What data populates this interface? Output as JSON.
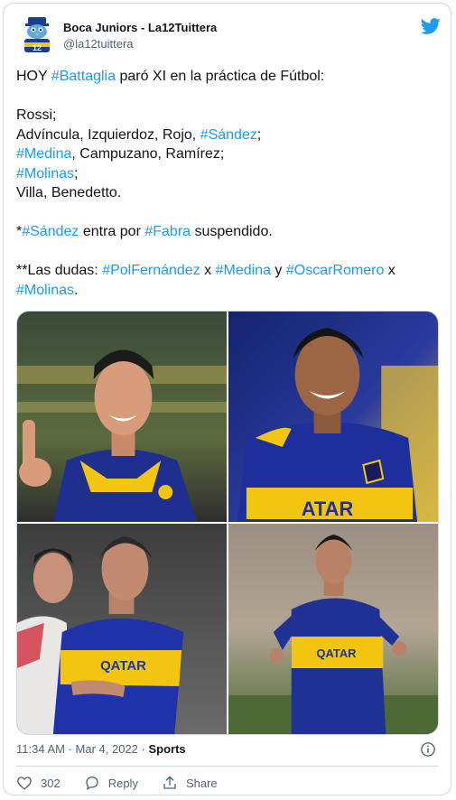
{
  "account": {
    "display_name": "Boca Juniors - La12Tuittera",
    "handle": "@la12tuittera",
    "avatar_icon": "avatar-bird-logo",
    "brand_color": "#1d9bf0"
  },
  "tweet": {
    "line1": {
      "a": "HOY ",
      "b": "#Battaglia",
      "c": " paró XI en la práctica de Fútbol:"
    },
    "line2": "Rossi;",
    "line3": {
      "a": "Advíncula, Izquierdoz, Rojo, ",
      "b": "#Sández",
      "c": ";"
    },
    "line4": {
      "a": "#Medina",
      "b": ", Campuzano, Ramírez;"
    },
    "line5": {
      "a": "#Molinas",
      "b": ";"
    },
    "line6": "Villa, Benedetto.",
    "line7": {
      "a": "*",
      "b": "#Sández",
      "c": " entra por ",
      "d": "#Fabra",
      "e": " suspendido."
    },
    "line8": {
      "a": "**Las dudas: ",
      "b": "#PolFernández",
      "c": " x ",
      "d": "#Medina",
      "e": " y ",
      "f": "#OscarRomero",
      "g": " x"
    },
    "line9": {
      "a": "#Molinas",
      "b": "."
    }
  },
  "meta": {
    "time": "11:34 AM",
    "separator": " · ",
    "date": "Mar 4, 2022",
    "category": "Sports"
  },
  "actions": {
    "likes": "302",
    "reply": "Reply",
    "share": "Share"
  },
  "colors": {
    "text": "#0f1419",
    "secondary": "#536471",
    "hashtag": "#1d9bf0",
    "boca_blue": "#1c2d8f",
    "boca_gold": "#f2c511"
  }
}
